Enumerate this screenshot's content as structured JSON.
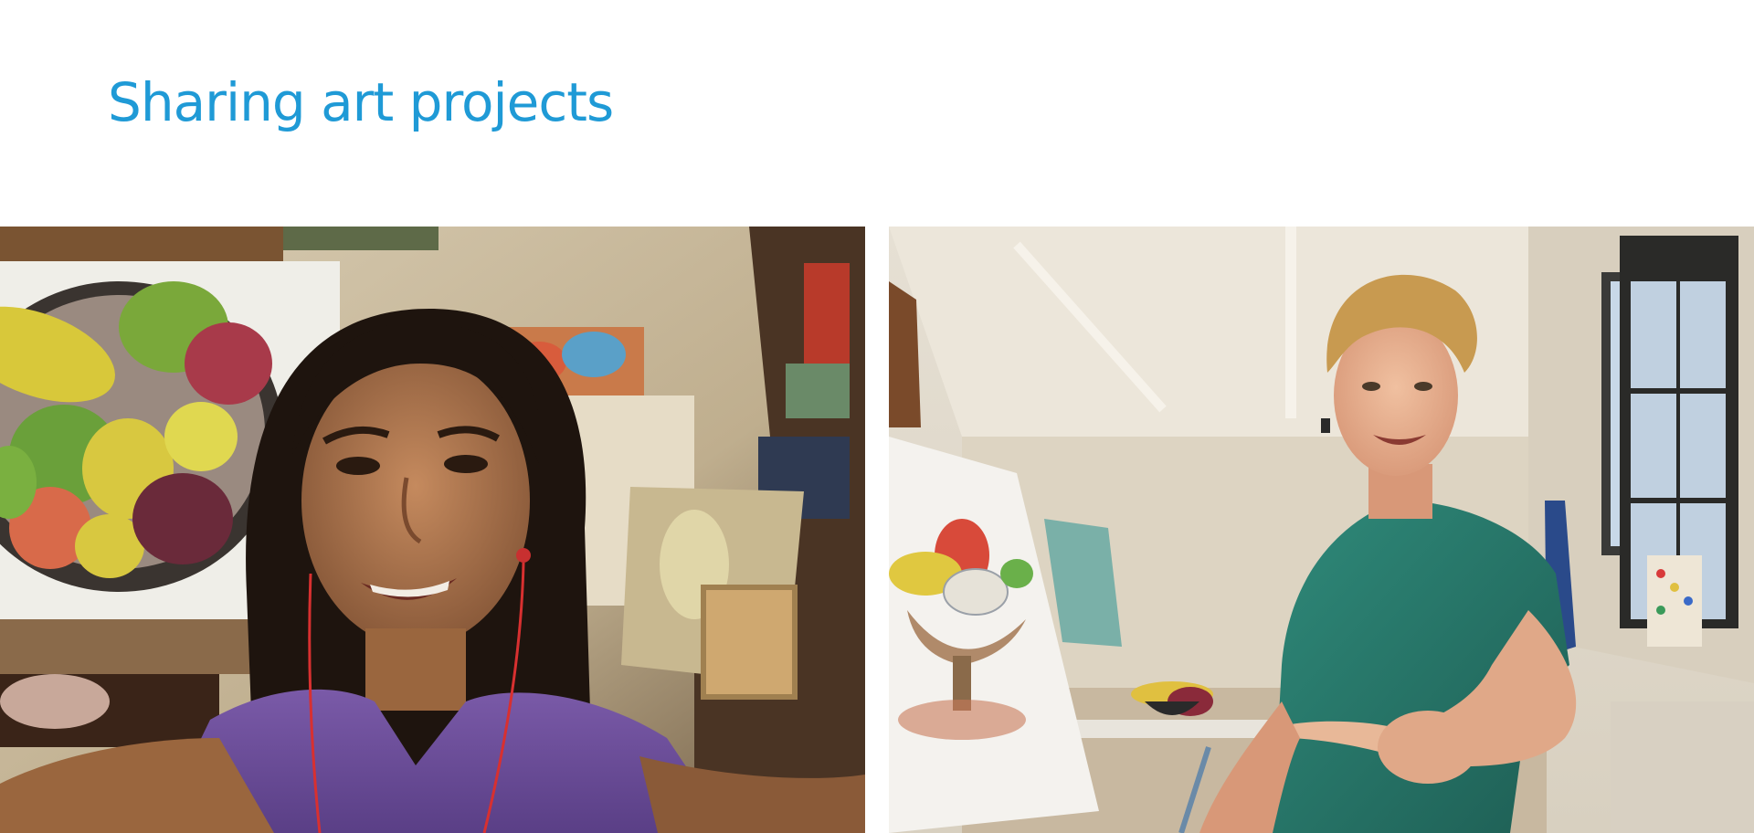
{
  "slide": {
    "title": "Sharing art projects"
  },
  "photos": [
    {
      "subject": "girl-selfie-art-studio"
    },
    {
      "subject": "boy-pointing-art-classroom"
    }
  ],
  "colors": {
    "title": "#1f9ad6",
    "background": "#ffffff"
  }
}
